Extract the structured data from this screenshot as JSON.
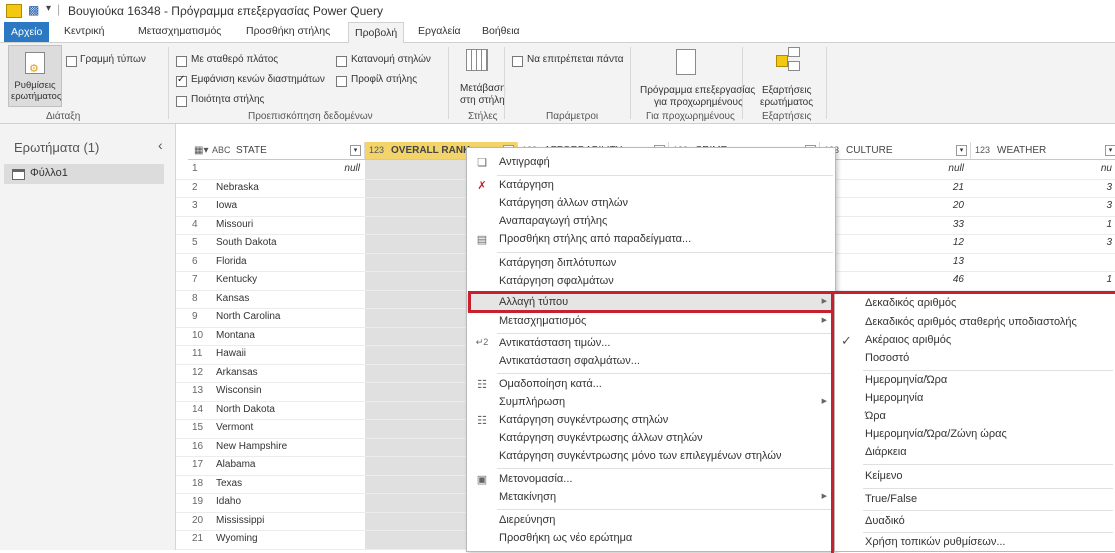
{
  "window": {
    "title": "Βουγιούκα 16348 - Πρόγραμμα επεξεργασίας Power Query"
  },
  "tabs": [
    "Αρχείο",
    "Κεντρική",
    "Μετασχηματισμός",
    "Προσθήκη στήλης",
    "Προβολή",
    "Εργαλεία",
    "Βοήθεια"
  ],
  "ribbon": {
    "layout": {
      "query_settings": "Ρυθμίσεις ερωτήματος",
      "formula_bar": "Γραμμή τύπων",
      "group": "Διάταξη"
    },
    "preview": {
      "monospaced": "Με σταθερό πλάτος",
      "show_whitespace": "Εμφάνιση κενών διαστημάτων",
      "column_quality": "Ποιότητα στήλης",
      "column_distribution": "Κατανομή στηλών",
      "column_profile": "Προφίλ στήλης",
      "group": "Προεπισκόπηση δεδομένων"
    },
    "columns": {
      "go_to_column_line1": "Μετάβαση",
      "go_to_column_line2": "στη στήλη",
      "group": "Στήλες"
    },
    "parameters": {
      "always_allow": "Να επιτρέπεται πάντα",
      "group": "Παράμετροι"
    },
    "advanced": {
      "advanced_editor_line1": "Πρόγραμμα επεξεργασίας",
      "advanced_editor_line2": "για προχωρημένους",
      "group": "Για προχωρημένους"
    },
    "dependencies": {
      "query_dependencies_line1": "Εξαρτήσεις",
      "query_dependencies_line2": "ερωτήματος",
      "group": "Εξαρτήσεις"
    }
  },
  "queries_pane": {
    "title": "Ερωτήματα (1)",
    "items": [
      "Φύλλο1"
    ]
  },
  "grid": {
    "columns": [
      {
        "type": "ABC",
        "name": "STATE"
      },
      {
        "type": "123",
        "name": "OVERALL RANK"
      },
      {
        "type": "123",
        "name": "AFFORDABILITY"
      },
      {
        "type": "123",
        "name": "CRIME"
      },
      {
        "type": "123",
        "name": "CULTURE"
      },
      {
        "type": "123",
        "name": "WEATHER"
      }
    ],
    "rows": [
      {
        "n": "1",
        "state": "null",
        "culture": "null",
        "weather": "nu"
      },
      {
        "n": "2",
        "state": "Nebraska",
        "culture": "21",
        "weather": "3"
      },
      {
        "n": "3",
        "state": "Iowa",
        "culture": "20",
        "weather": "3"
      },
      {
        "n": "4",
        "state": "Missouri",
        "culture": "33",
        "weather": "1"
      },
      {
        "n": "5",
        "state": "South Dakota",
        "culture": "12",
        "weather": "3"
      },
      {
        "n": "6",
        "state": "Florida",
        "culture": "13",
        "weather": ""
      },
      {
        "n": "7",
        "state": "Kentucky",
        "culture": "46",
        "weather": "1"
      },
      {
        "n": "8",
        "state": "Kansas",
        "culture": "",
        "weather": ""
      },
      {
        "n": "9",
        "state": "North Carolina",
        "culture": "",
        "weather": ""
      },
      {
        "n": "10",
        "state": "Montana",
        "culture": "",
        "weather": ""
      },
      {
        "n": "11",
        "state": "Hawaii",
        "culture": "",
        "weather": ""
      },
      {
        "n": "12",
        "state": "Arkansas",
        "culture": "",
        "weather": ""
      },
      {
        "n": "13",
        "state": "Wisconsin",
        "culture": "",
        "weather": ""
      },
      {
        "n": "14",
        "state": "North Dakota",
        "culture": "",
        "weather": ""
      },
      {
        "n": "15",
        "state": "Vermont",
        "culture": "",
        "weather": ""
      },
      {
        "n": "16",
        "state": "New Hampshire",
        "culture": "",
        "weather": ""
      },
      {
        "n": "17",
        "state": "Alabama",
        "culture": "",
        "weather": ""
      },
      {
        "n": "18",
        "state": "Texas",
        "culture": "",
        "weather": ""
      },
      {
        "n": "19",
        "state": "Idaho",
        "culture": "",
        "weather": ""
      },
      {
        "n": "20",
        "state": "Mississippi",
        "culture": "",
        "weather": ""
      },
      {
        "n": "21",
        "state": "Wyoming",
        "culture": "",
        "weather": ""
      }
    ]
  },
  "context_menu": {
    "copy": "Αντιγραφή",
    "remove": "Κατάργηση",
    "remove_other": "Κατάργηση άλλων στηλών",
    "duplicate": "Αναπαραγωγή στήλης",
    "add_from_examples": "Προσθήκη στήλης από παραδείγματα...",
    "remove_duplicates": "Κατάργηση διπλότυπων",
    "remove_errors": "Κατάργηση σφαλμάτων",
    "change_type": "Αλλαγή τύπου",
    "transform": "Μετασχηματισμός",
    "replace_values": "Αντικατάσταση τιμών...",
    "replace_errors": "Αντικατάσταση σφαλμάτων...",
    "group_by": "Ομαδοποίηση κατά...",
    "fill": "Συμπλήρωση",
    "unpivot": "Κατάργηση συγκέντρωσης στηλών",
    "unpivot_other": "Κατάργηση συγκέντρωσης άλλων στηλών",
    "unpivot_selected": "Κατάργηση συγκέντρωσης μόνο των επιλεγμένων στηλών",
    "rename": "Μετονομασία...",
    "move": "Μετακίνηση",
    "drill_down": "Διερεύνηση",
    "add_as_new_query": "Προσθήκη ως νέο ερώτημα"
  },
  "type_submenu": {
    "decimal": "Δεκαδικός αριθμός",
    "fixed_decimal": "Δεκαδικός αριθμός σταθερής υποδιαστολής",
    "whole": "Ακέραιος αριθμός",
    "percentage": "Ποσοστό",
    "datetime": "Ημερομηνία/Ώρα",
    "date": "Ημερομηνία",
    "time": "Ώρα",
    "datetimezone": "Ημερομηνία/Ώρα/Ζώνη ώρας",
    "duration": "Διάρκεια",
    "text": "Κείμενο",
    "truefalse": "True/False",
    "binary": "Δυαδικό",
    "using_locale": "Χρήση τοπικών ρυθμίσεων..."
  },
  "colors": {
    "accent": "#2b79c2",
    "selected_column": "#f3d46b",
    "highlight_border": "#c8202f"
  }
}
